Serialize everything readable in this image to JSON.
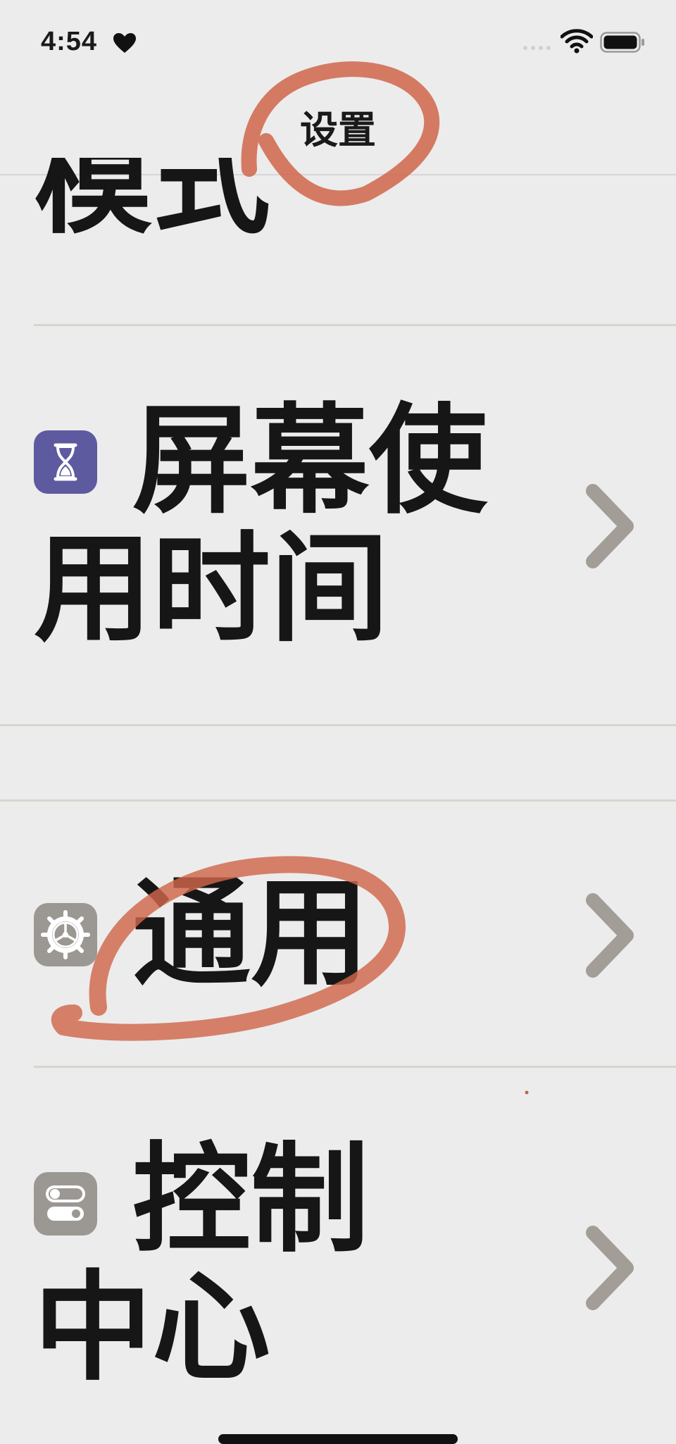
{
  "status_bar": {
    "time": "4:54",
    "heart_icon": "heart-icon",
    "wifi_icon": "wifi-icon",
    "battery_icon": "battery-icon"
  },
  "nav": {
    "title": "设置"
  },
  "rows": [
    {
      "label": "模式",
      "partial": true
    },
    {
      "label": "屏幕使用时间",
      "line1": "屏幕使",
      "line2": "用时间",
      "icon": "hourglass-icon",
      "icon_color": "#5e5aa0"
    },
    {
      "label": "通用",
      "icon": "gear-icon",
      "icon_color": "#9b9893"
    },
    {
      "label": "控制中心",
      "line1": "控制",
      "line2": "中心",
      "icon": "toggle-switches-icon",
      "icon_color": "#9b9893"
    }
  ],
  "colors": {
    "background": "#ececec",
    "chevron": "#a39d98",
    "annotation": "#d0664a",
    "divider": "#d8d5cd"
  }
}
